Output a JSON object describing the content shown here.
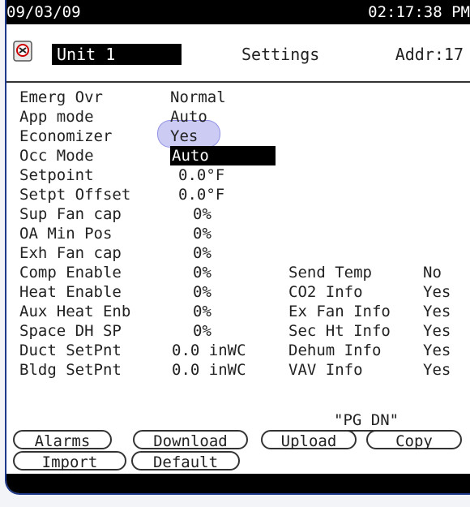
{
  "topbar": {
    "date": "09/03/09",
    "time": "02:17:38 PM"
  },
  "header": {
    "unit": "Unit 1",
    "title": "Settings",
    "addr": "Addr:17",
    "unit_icon": "unit-icon"
  },
  "settings": {
    "rows": [
      {
        "label": "Emerg Ovr",
        "value": "Normal"
      },
      {
        "label": "App mode",
        "value": "Auto"
      },
      {
        "label": "Economizer",
        "value": "Yes"
      },
      {
        "label": "Occ Mode",
        "value": "Auto"
      },
      {
        "label": "Setpoint",
        "value": "0.0°F"
      },
      {
        "label": "Setpt Offset",
        "value": "0.0°F"
      },
      {
        "label": "Sup Fan cap",
        "value": "0%"
      },
      {
        "label": "OA Min Pos",
        "value": "0%"
      },
      {
        "label": "Exh Fan cap",
        "value": "0%"
      },
      {
        "label": "Comp Enable",
        "value": "0%"
      },
      {
        "label": "Heat Enable",
        "value": "0%"
      },
      {
        "label": "Aux Heat Enb",
        "value": "0%"
      },
      {
        "label": "Space DH SP",
        "value": "0%"
      },
      {
        "label": "Duct SetPnt",
        "value": "0.0 inWC"
      },
      {
        "label": "Bldg SetPnt",
        "value": "0.0 inWC"
      }
    ],
    "info": [
      {
        "label": "Send Temp",
        "value": "No"
      },
      {
        "label": "CO2 Info",
        "value": "Yes"
      },
      {
        "label": "Ex Fan Info",
        "value": "Yes"
      },
      {
        "label": "Sec Ht Info",
        "value": "Yes"
      },
      {
        "label": "Dehum Info",
        "value": "Yes"
      },
      {
        "label": "VAV Info",
        "value": "Yes"
      }
    ]
  },
  "footer": {
    "pgdn": "\"PG DN\"",
    "buttons": [
      "Alarms",
      "Download",
      "Upload",
      "Copy",
      "Import",
      "Default"
    ]
  },
  "colors": {
    "frame_border": "#1f3a8a",
    "highlight": "#8c8ce6",
    "selection": "#000000"
  }
}
